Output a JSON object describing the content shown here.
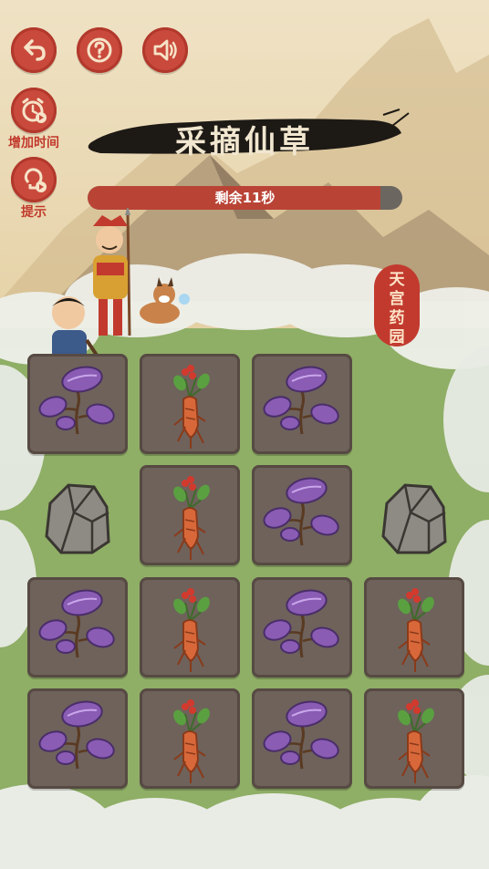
{
  "game": {
    "title": "采摘仙草",
    "timer_label": "剩余11秒",
    "timer_remaining_fraction": 0.93,
    "garden_sign": [
      "天",
      "宫",
      "药",
      "园"
    ]
  },
  "controls": {
    "add_time_label": "增加时间",
    "hint_label": "提示"
  },
  "icons": {
    "back": "back-arrow-icon",
    "help": "question-icon",
    "sound": "speaker-icon",
    "add_time": "alarm-clock-icon",
    "hint": "lightbulb-play-icon"
  },
  "colors": {
    "accent_red": "#c94a3c",
    "tile": "#6e625b",
    "grass": "#8fae66",
    "leaf_purple": "#8a5cb4",
    "ginseng_orange": "#d8683a"
  },
  "board": {
    "rows": [
      [
        "leaf",
        "ginseng",
        "leaf",
        "empty"
      ],
      [
        "rock",
        "ginseng",
        "leaf",
        "rock"
      ],
      [
        "leaf",
        "ginseng",
        "leaf",
        "ginseng"
      ],
      [
        "leaf",
        "ginseng",
        "leaf",
        "ginseng"
      ]
    ]
  }
}
